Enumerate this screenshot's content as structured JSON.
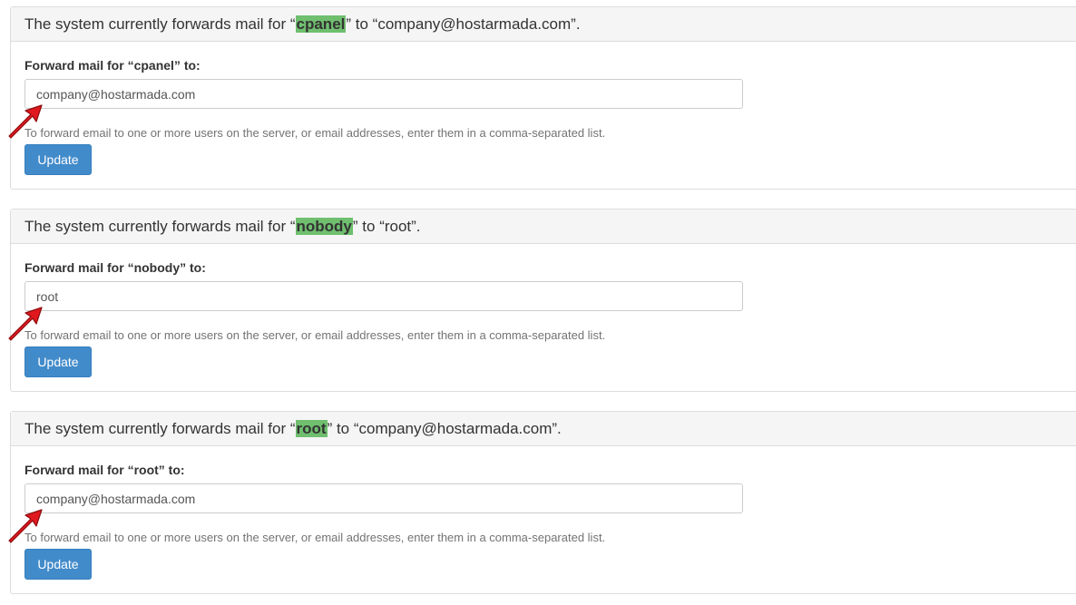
{
  "colors": {
    "highlight": "#6fbf6f",
    "button": "#428bca",
    "arrow": "#e0191e"
  },
  "forwarders": [
    {
      "heading_pre": "The system currently forwards mail for “",
      "user": "cpanel",
      "heading_post": "” to “company@hostarmada.com”.",
      "label": "Forward mail for “cpanel” to:",
      "value": "company@hostarmada.com",
      "help": "To forward email to one or more users on the server, or email addresses, enter them in a comma-separated list.",
      "button": "Update"
    },
    {
      "heading_pre": "The system currently forwards mail for “",
      "user": "nobody",
      "heading_post": "” to “root”.",
      "label": "Forward mail for “nobody” to:",
      "value": "root",
      "help": "To forward email to one or more users on the server, or email addresses, enter them in a comma-separated list.",
      "button": "Update"
    },
    {
      "heading_pre": "The system currently forwards mail for “",
      "user": "root",
      "heading_post": "” to “company@hostarmada.com”.",
      "label": "Forward mail for “root” to:",
      "value": "company@hostarmada.com",
      "help": "To forward email to one or more users on the server, or email addresses, enter them in a comma-separated list.",
      "button": "Update"
    }
  ]
}
